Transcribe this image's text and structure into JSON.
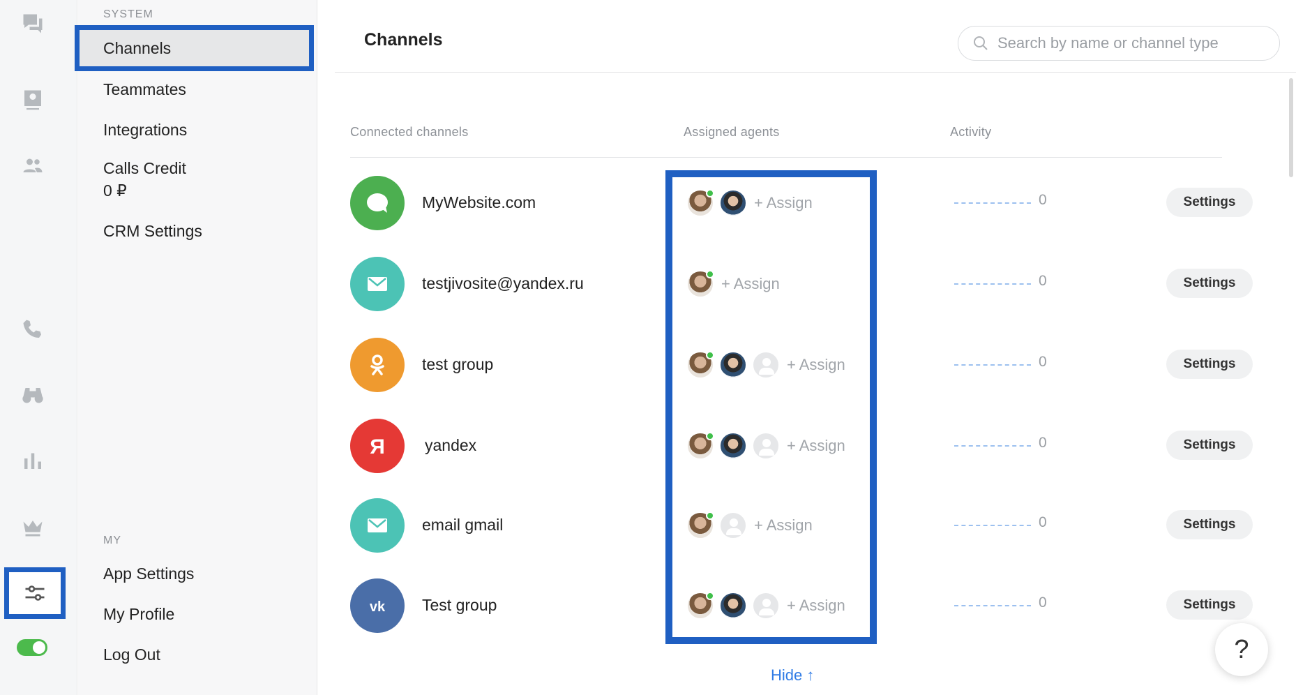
{
  "rail": {
    "icons": [
      "chats-icon",
      "contacts-icon",
      "team-icon",
      "phone-icon",
      "binoculars-icon",
      "stats-icon",
      "crown-icon",
      "settings-sliders-icon"
    ],
    "active": "settings-sliders-icon",
    "toggle_on": true
  },
  "sidebar": {
    "system_section": "SYSTEM",
    "system_items": [
      "Channels",
      "Teammates",
      "Integrations",
      "Calls Credit"
    ],
    "calls_credit_value": "0 ₽",
    "crm_item": "CRM Settings",
    "my_section": "MY",
    "my_items": [
      "App Settings",
      "My Profile",
      "Log Out"
    ],
    "active_item": "Channels"
  },
  "header": {
    "title": "Channels",
    "search_placeholder": "Search by name or channel type"
  },
  "table": {
    "columns": [
      "Connected channels",
      "Assigned agents",
      "Activity"
    ],
    "assign_label": "+ Assign",
    "settings_label": "Settings",
    "rows": [
      {
        "name": "MyWebsite.com",
        "icon": "chat-bubble-icon",
        "color": "#4caf50",
        "agents": [
          "agent1-online",
          "agent2"
        ],
        "activity": "0"
      },
      {
        "name": "testjivosite@yandex.ru",
        "icon": "envelope-icon",
        "color": "#4cc3b5",
        "agents": [
          "agent1-online"
        ],
        "activity": "0"
      },
      {
        "name": "test group",
        "icon": "odnoklassniki-icon",
        "color": "#ef9a2f",
        "agents": [
          "agent1-online",
          "agent2",
          "blank"
        ],
        "activity": "0"
      },
      {
        "name": "yandex",
        "icon": "yandex-icon",
        "color": "#e53935",
        "agents": [
          "agent1-online",
          "agent2",
          "blank"
        ],
        "activity": "0"
      },
      {
        "name": "email gmail",
        "icon": "envelope-icon",
        "color": "#4cc3b5",
        "agents": [
          "agent1-online",
          "blank"
        ],
        "activity": "0"
      },
      {
        "name": "Test group",
        "icon": "vk-icon",
        "color": "#4a6ea8",
        "agents": [
          "agent1-online",
          "agent2",
          "blank"
        ],
        "activity": "0"
      }
    ]
  },
  "hide_label": "Hide ↑",
  "help_label": "?"
}
